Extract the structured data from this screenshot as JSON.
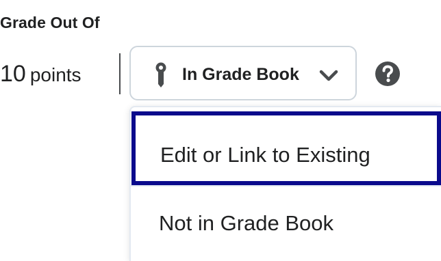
{
  "grade": {
    "section_label": "Grade Out Of",
    "value": "10",
    "unit": "points"
  },
  "grade_book_button": {
    "label": "In Grade Book",
    "icon": "pin-icon",
    "expand_icon": "chevron-down-icon"
  },
  "help": {
    "icon": "help-icon"
  },
  "dropdown": {
    "items": [
      {
        "label": "Edit or Link to Existing"
      },
      {
        "label": "Not in Grade Book"
      }
    ]
  },
  "colors": {
    "text": "#202122",
    "focus_outline": "#0a0a8c",
    "button_border": "#cdd5dc",
    "icon": "#494c4e"
  }
}
